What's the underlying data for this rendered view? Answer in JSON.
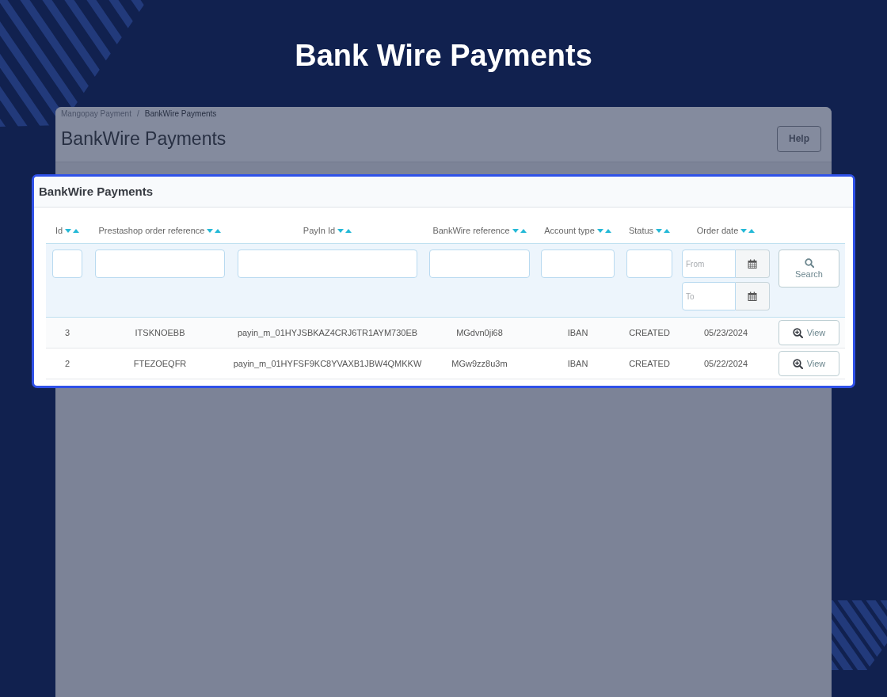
{
  "page_title": "Bank Wire Payments",
  "admin_page": {
    "breadcrumb": [
      {
        "label": "Mangopay Payment",
        "current": false
      },
      {
        "label": "BankWire Payments",
        "current": true
      }
    ],
    "breadcrumb_separator": "/",
    "title": "BankWire Payments",
    "help_button": "Help"
  },
  "panel": {
    "title": "BankWire Payments",
    "columns": [
      {
        "label": "Id"
      },
      {
        "label": "Prestashop order reference"
      },
      {
        "label": "PayIn Id"
      },
      {
        "label": "BankWire reference"
      },
      {
        "label": "Account type"
      },
      {
        "label": "Status"
      },
      {
        "label": "Order date"
      }
    ],
    "filters": [
      {
        "kind": "text"
      },
      {
        "kind": "text"
      },
      {
        "kind": "text"
      },
      {
        "kind": "text"
      },
      {
        "kind": "text"
      },
      {
        "kind": "text"
      },
      {
        "kind": "date_range",
        "from_placeholder": "From",
        "to_placeholder": "To"
      }
    ],
    "search_button": "Search",
    "rows": [
      {
        "cells": [
          "3",
          "ITSKNOEBB",
          "payin_m_01HYJSBKAZ4CRJ6TR1AYM730EB",
          "MGdvn0ji68",
          "IBAN",
          "CREATED",
          "05/23/2024"
        ],
        "action": "View"
      },
      {
        "cells": [
          "2",
          "FTEZOEQFR",
          "payin_m_01HYFSF9KC8YVAXB1JBW4QMKKW",
          "MGw9zz8u3m",
          "IBAN",
          "CREATED",
          "05/22/2024"
        ],
        "action": "View"
      }
    ]
  }
}
